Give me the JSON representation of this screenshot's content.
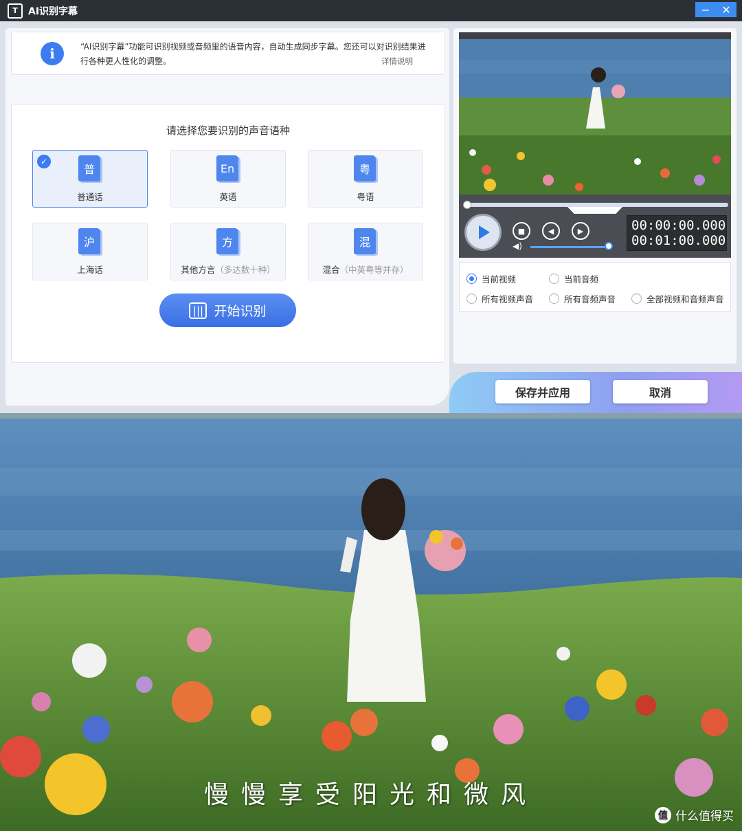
{
  "window": {
    "title": "AI识别字幕",
    "icon_label": "T",
    "minimize_symbol": "−",
    "close_symbol": "✕"
  },
  "info": {
    "icon_glyph": "i",
    "text": "“AI识别字幕”功能可识别视频或音频里的语音内容，自动生成同步字幕。您还可以对识别结果进行各种更人性化的调整。",
    "link": "详情说明"
  },
  "language": {
    "title": "请选择您要识别的声音语种",
    "options": [
      {
        "glyph": "普",
        "label": "普通话",
        "sub": "",
        "selected": true
      },
      {
        "glyph": "En",
        "label": "英语",
        "sub": "",
        "selected": false
      },
      {
        "glyph": "粤",
        "label": "粤语",
        "sub": "",
        "selected": false
      },
      {
        "glyph": "沪",
        "label": "上海话",
        "sub": "",
        "selected": false
      },
      {
        "glyph": "方",
        "label": "其他方言",
        "sub": "（多达数十种）",
        "selected": false
      },
      {
        "glyph": "混",
        "label": "混合",
        "sub": "（中英粤等并存）",
        "selected": false
      }
    ],
    "start_button": "开始识别"
  },
  "player": {
    "current_time": "00:00:00.000",
    "total_time": "00:01:00.000",
    "progress": 0,
    "volume": 1.0
  },
  "source": {
    "options": [
      {
        "label": "当前视频",
        "selected": true
      },
      {
        "label": "当前音频",
        "selected": false
      },
      {
        "label": "所有视频声音",
        "selected": false
      },
      {
        "label": "所有音频声音",
        "selected": false
      },
      {
        "label": "全部视频和音频声音",
        "selected": false
      }
    ]
  },
  "buttons": {
    "save": "保存并应用",
    "cancel": "取消"
  },
  "photo": {
    "subtitle": "慢慢享受阳光和微风",
    "watermark": "什么值得买",
    "watermark_logo": "值"
  },
  "colors": {
    "accent": "#3d7bf0",
    "titlebar": "#2b2f36"
  }
}
